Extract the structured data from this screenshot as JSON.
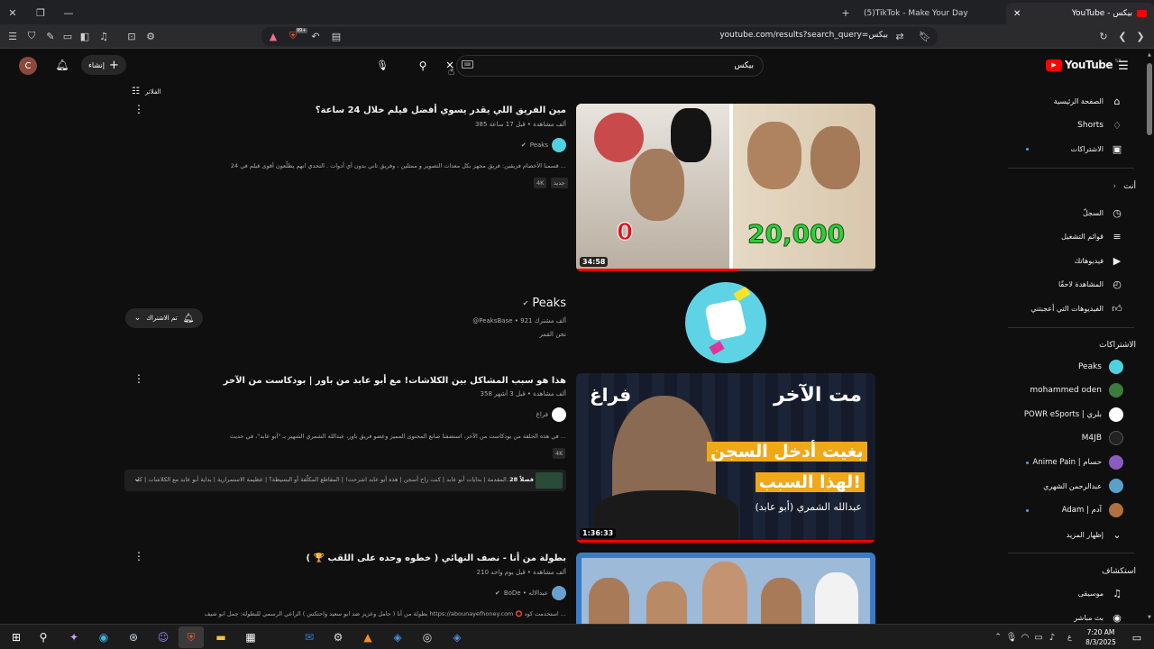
{
  "browser": {
    "tabs": [
      {
        "label": "(5)TikTok - Make Your Day"
      },
      {
        "label": "YouTube - بيكس"
      }
    ],
    "url": "youtube.com/results?search_query=بيكس",
    "ext_badge": "99+"
  },
  "youtube": {
    "avatar_letter": "C",
    "create_label": "إنشاء",
    "search_query": "بيكس",
    "logo_text": "YouTube",
    "logo_region": "SA",
    "filters_label": "الفلاتر",
    "sidebar": {
      "main": [
        {
          "label": "الصفحة الرئيسية",
          "icon": "home-icon"
        },
        {
          "label": "Shorts",
          "icon": "shorts-icon"
        },
        {
          "label": "الاشتراكات",
          "icon": "subscriptions-icon"
        }
      ],
      "you_header": "أنت",
      "you": [
        {
          "label": "السجلّ",
          "icon": "history-icon"
        },
        {
          "label": "قوائم التشغيل",
          "icon": "playlist-icon"
        },
        {
          "label": "فيديوهاتك",
          "icon": "your-videos-icon"
        },
        {
          "label": "المشاهدة لاحقًا",
          "icon": "watch-later-icon"
        },
        {
          "label": "الفيديوهات التي أعجبتني",
          "icon": "like-icon"
        }
      ],
      "subs_header": "الاشتراكات",
      "subs": [
        {
          "label": "Peaks",
          "color": "#4fd1e0"
        },
        {
          "label": "mohammed oden",
          "color": "#3d7a3d"
        },
        {
          "label": "POWR eSports | بلري",
          "color": "#ffffff"
        },
        {
          "label": "M4JB",
          "color": "#222222"
        },
        {
          "label": "Anime Pain | حسام",
          "color": "#8a5cc2"
        },
        {
          "label": "عبدالرحمن الشهري",
          "color": "#5aa0c8"
        },
        {
          "label": "Adam | آدم",
          "color": "#b07040"
        },
        {
          "label": "إظهار المزيد",
          "color": ""
        }
      ],
      "explore_header": "استكشاف",
      "explore": [
        {
          "label": "موسيقى",
          "icon": "music-icon"
        },
        {
          "label": "بث مباشر",
          "icon": "live-icon"
        }
      ]
    },
    "results": [
      {
        "title": "مين الفريق اللي يقدر يسوي أفضل فيلم خلال 24 ساعة؟",
        "meta": "385 ألف مشاهدة • قبل 17 ساعة",
        "channel": "Peaks",
        "desc": "قسمنا الأخصام فريقين: فريق مجهز بكل معدات التصوير و ممثلين ، وفريق ثاني بدون أي أدوات . التحدي انهم يطلّعون أقوى فيلم في 24 ...",
        "badges": [
          "جديد",
          "4K"
        ],
        "duration": "34:58",
        "thumb_left_amount": "0",
        "thumb_right_amount": "20,000"
      },
      {
        "title": "هذا هو سبب المشاكل بين الكلاشات! مع أبو عابد من باور | بودكاست من الآخر",
        "meta": "358 ألف مشاهدة • قبل 3 أشهر",
        "channel": "فراغ",
        "desc": "في هذه الحلقة من بودكاست من الآخر، استضفنا صانع المحتوى المميز وعضو فريق باور، عبدالله الشمري الشهير بـ \"أبو عابد\"، في حديث ...",
        "badges": [
          "4K"
        ],
        "duration": "1:36:33",
        "thumb_brand": "فراغ",
        "thumb_show": "مت الآخر",
        "thumb_headline": "بغيت أدخل السجن لهذا السبب!",
        "thumb_guest": "عبدالله الشمري (أبو عابد)"
      },
      {
        "title": "بطولة من أنا - نصف النهائي ( خطوه وحده على اللقب 🏆 )",
        "meta": "210 ألف مشاهدة • قبل يوم واحد",
        "channel": "BoDe • عبدالاله",
        "desc": "بطولة من أنا ( حامل وعزيز ضد ابو سعيد واحتكس ) الراعي الرسمي للبطولة: جمل ابو شيف https://abounayefhoney.com ⭕ استخدمت كود ...",
        "badges": []
      }
    ],
    "channel_card": {
      "name": "Peaks",
      "handle": "@PeaksBase • 921 ألف مشترك",
      "sub": "نحن القمر",
      "subscribed_label": "تم الاشتراك"
    },
    "chapters": {
      "count": "28 فصلاً",
      "text": "المقدمة | بدايات أبو عابد | كنت راح أسجن | هذه أبو عابد اشرحت! | المقاطع المكلّفة أو البسيطة؟ | عظيمة الاستمرارية | بداية أبو عابد مع الكلاشات | كا..."
    }
  },
  "taskbar": {
    "time": "7:20 AM",
    "date": "8/3/2025",
    "lang": "ع"
  }
}
